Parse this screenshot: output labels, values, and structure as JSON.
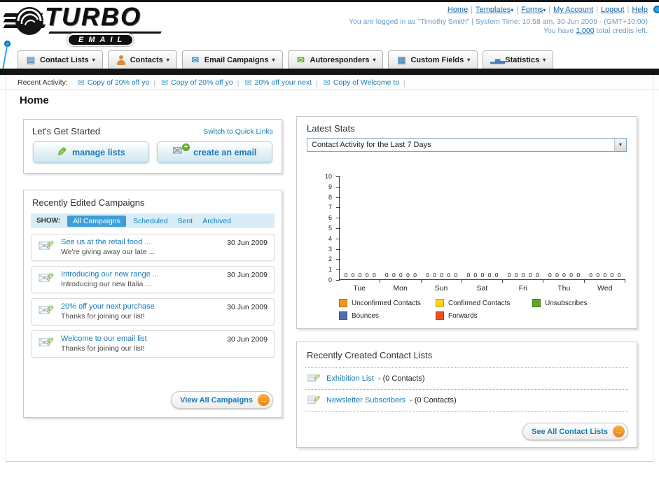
{
  "header": {
    "logo_title": "TURBO",
    "logo_subtitle": "EMAIL",
    "links": [
      {
        "label": "Home",
        "dropdown": false
      },
      {
        "label": "Templates",
        "dropdown": true
      },
      {
        "label": "Forms",
        "dropdown": true
      },
      {
        "label": "My Account",
        "dropdown": false
      },
      {
        "label": "Logout",
        "dropdown": false
      },
      {
        "label": "Help",
        "dropdown": false
      }
    ],
    "login_line": "You are logged in as \"Timothy Smith\" | System Time: 10:58 am, 30 Jun 2009 - (GMT+10:00)",
    "credits_prefix": "You have ",
    "credits_value": "1,000",
    "credits_suffix": " total credits left."
  },
  "nav_tabs": [
    {
      "label": "Contact Lists",
      "icon": "contact-lists"
    },
    {
      "label": "Contacts",
      "icon": "contacts"
    },
    {
      "label": "Email Campaigns",
      "icon": "email-campaigns"
    },
    {
      "label": "Autoresponders",
      "icon": "autoresponders"
    },
    {
      "label": "Custom Fields",
      "icon": "custom-fields"
    },
    {
      "label": "Statistics",
      "icon": "statistics"
    }
  ],
  "recent_activity": {
    "label": "Recent Activity:",
    "items": [
      "Copy of 20% off yo",
      "Copy of 20% off yo",
      "20% off your next",
      "Copy of Welcome to"
    ]
  },
  "page_title": "Home",
  "get_started": {
    "title": "Let's Get Started",
    "switch_link": "Switch to Quick Links",
    "manage_lists_label": "manage lists",
    "create_email_label": "create an email"
  },
  "campaigns": {
    "title": "Recently Edited Campaigns",
    "show_label": "SHOW:",
    "filters": [
      "All Campaigns",
      "Scheduled",
      "Sent",
      "Archived"
    ],
    "active_filter": "All Campaigns",
    "items": [
      {
        "title": "See us at the retail food ...",
        "subtitle": "We're giving away our late ...",
        "date": "30 Jun 2009"
      },
      {
        "title": "Introducing our new range ...",
        "subtitle": "Introducing our new Italia ...",
        "date": "30 Jun 2009"
      },
      {
        "title": "20% off your next purchase",
        "subtitle": "Thanks for joining our list!",
        "date": "30 Jun 2009"
      },
      {
        "title": "Welcome to our email list",
        "subtitle": "Thanks for joining our list!",
        "date": "30 Jun 2009"
      }
    ],
    "view_all_label": "View All Campaigns"
  },
  "stats": {
    "title": "Latest Stats",
    "dropdown_value": "Contact Activity for the Last 7 Days",
    "legend": [
      {
        "label": "Unconfirmed Contacts",
        "color": "#f7941e"
      },
      {
        "label": "Confirmed Contacts",
        "color": "#ffd21e"
      },
      {
        "label": "Unsubscribes",
        "color": "#61a620"
      },
      {
        "label": "Bounces",
        "color": "#4f6fa6"
      },
      {
        "label": "Forwards",
        "color": "#e8501e"
      }
    ]
  },
  "chart_data": {
    "type": "bar",
    "title": "Contact Activity for the Last 7 Days",
    "categories": [
      "Tue",
      "Mon",
      "Sun",
      "Sat",
      "Fri",
      "Thu",
      "Wed"
    ],
    "series": [
      {
        "name": "Unconfirmed Contacts",
        "color": "#f7941e",
        "values": [
          0,
          0,
          0,
          0,
          0,
          0,
          0
        ]
      },
      {
        "name": "Confirmed Contacts",
        "color": "#ffd21e",
        "values": [
          0,
          0,
          0,
          0,
          0,
          0,
          0
        ]
      },
      {
        "name": "Unsubscribes",
        "color": "#61a620",
        "values": [
          0,
          0,
          0,
          0,
          0,
          0,
          0
        ]
      },
      {
        "name": "Bounces",
        "color": "#4f6fa6",
        "values": [
          0,
          0,
          0,
          0,
          0,
          0,
          0
        ]
      },
      {
        "name": "Forwards",
        "color": "#e8501e",
        "values": [
          0,
          0,
          0,
          0,
          0,
          0,
          0
        ]
      }
    ],
    "xlabel": "",
    "ylabel": "",
    "ylim": [
      0,
      10
    ],
    "yticks": [
      0,
      1,
      2,
      3,
      4,
      5,
      6,
      7,
      8,
      9,
      10
    ],
    "grid": false,
    "legend_position": "bottom"
  },
  "contact_lists": {
    "title": "Recently Created Contact Lists",
    "items": [
      {
        "name": "Exhibition List",
        "detail": "- (0 Contacts)"
      },
      {
        "name": "Newsletter Subscribers",
        "detail": "- (0 Contacts)"
      }
    ],
    "see_all_label": "See All Contact Lists"
  }
}
